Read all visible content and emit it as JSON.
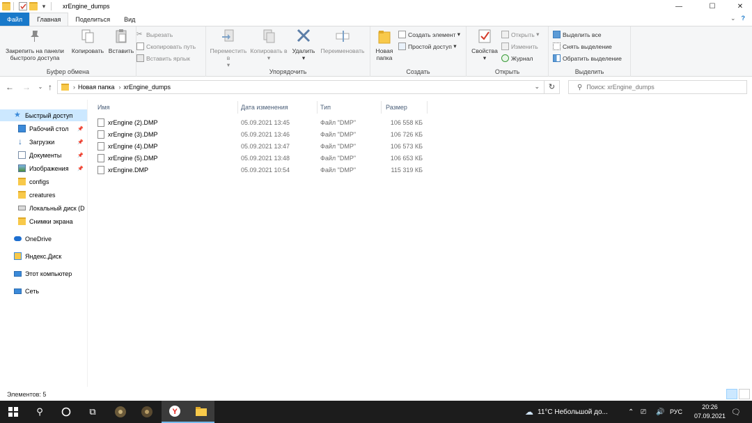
{
  "window": {
    "title": "xrEngine_dumps",
    "controls": {
      "minimize": "—",
      "maximize": "☐",
      "close": "✕"
    }
  },
  "ribbon_tabs": {
    "file": "Файл",
    "home": "Главная",
    "share": "Поделиться",
    "view": "Вид"
  },
  "ribbon": {
    "clipboard": {
      "label": "Буфер обмена",
      "pin": "Закрепить на панели быстрого доступа",
      "copy": "Копировать",
      "paste": "Вставить",
      "cut": "Вырезать",
      "copy_path": "Скопировать путь",
      "paste_shortcut": "Вставить ярлык"
    },
    "organize": {
      "label": "Упорядочить",
      "move_to": "Переместить в",
      "copy_to": "Копировать в",
      "delete": "Удалить",
      "rename": "Переименовать"
    },
    "new": {
      "label": "Создать",
      "new_folder": "Новая папка",
      "new_item": "Создать элемент",
      "easy_access": "Простой доступ"
    },
    "open": {
      "label": "Открыть",
      "properties": "Свойства",
      "open": "Открыть",
      "edit": "Изменить",
      "history": "Журнал"
    },
    "select": {
      "label": "Выделить",
      "select_all": "Выделить все",
      "select_none": "Снять выделение",
      "invert": "Обратить выделение"
    }
  },
  "address": {
    "path": [
      "Новая папка",
      "xrEngine_dumps"
    ],
    "search_placeholder": "Поиск: xrEngine_dumps"
  },
  "nav": {
    "items": [
      {
        "label": "Быстрый доступ",
        "icon": "star-icon",
        "pinned": false
      },
      {
        "label": "Рабочий стол",
        "icon": "desktop-icon",
        "pinned": true
      },
      {
        "label": "Загрузки",
        "icon": "download-icon",
        "pinned": true
      },
      {
        "label": "Документы",
        "icon": "documents-icon",
        "pinned": true
      },
      {
        "label": "Изображения",
        "icon": "pictures-icon",
        "pinned": true
      },
      {
        "label": "configs",
        "icon": "folder-icon",
        "pinned": false
      },
      {
        "label": "creatures",
        "icon": "folder-icon",
        "pinned": false
      },
      {
        "label": "Локальный диск (D",
        "icon": "drive-icon",
        "pinned": false
      },
      {
        "label": "Снимки экрана",
        "icon": "folder-icon",
        "pinned": false
      },
      {
        "label": "OneDrive",
        "icon": "cloud-icon",
        "pinned": false
      },
      {
        "label": "Яндекс.Диск",
        "icon": "yandex-disk-icon",
        "pinned": false
      },
      {
        "label": "Этот компьютер",
        "icon": "computer-icon",
        "pinned": false
      },
      {
        "label": "Сеть",
        "icon": "network-icon",
        "pinned": false
      }
    ]
  },
  "columns": {
    "name": "Имя",
    "date": "Дата изменения",
    "type": "Тип",
    "size": "Размер"
  },
  "files": [
    {
      "name": "xrEngine (2).DMP",
      "date": "05.09.2021 13:45",
      "type": "Файл \"DMP\"",
      "size": "106 558 КБ"
    },
    {
      "name": "xrEngine (3).DMP",
      "date": "05.09.2021 13:46",
      "type": "Файл \"DMP\"",
      "size": "106 726 КБ"
    },
    {
      "name": "xrEngine (4).DMP",
      "date": "05.09.2021 13:47",
      "type": "Файл \"DMP\"",
      "size": "106 573 КБ"
    },
    {
      "name": "xrEngine (5).DMP",
      "date": "05.09.2021 13:48",
      "type": "Файл \"DMP\"",
      "size": "106 653 КБ"
    },
    {
      "name": "xrEngine.DMP",
      "date": "05.09.2021 10:54",
      "type": "Файл \"DMP\"",
      "size": "115 319 КБ"
    }
  ],
  "status": {
    "items_count": "Элементов: 5"
  },
  "taskbar": {
    "weather": "11°C  Небольшой до...",
    "lang": "РУС",
    "time": "20:26",
    "date": "07.09.2021"
  },
  "colors": {
    "accent": "#1979ca",
    "selection": "#cce8ff",
    "folder": "#f8c94a",
    "taskbar": "#1c1c1c"
  }
}
